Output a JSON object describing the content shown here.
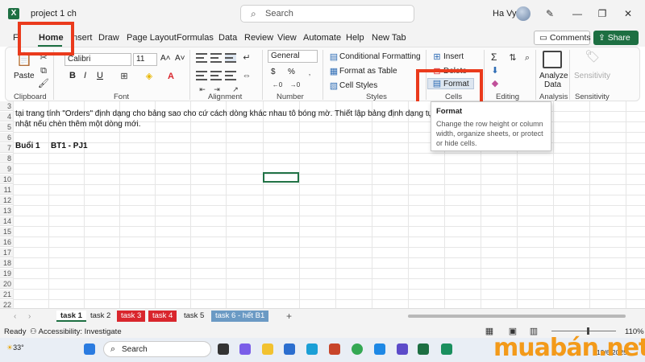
{
  "titlebar": {
    "app_icon": "X",
    "doc_title": "project 1 ch",
    "search_placeholder": "Search",
    "user": "Ha Vy",
    "min": "—",
    "restore": "❐",
    "close": "✕",
    "pen": "✎"
  },
  "tabs": [
    "Fi",
    "Home",
    "nsert",
    "Draw",
    "Page Layout",
    "Formulas",
    "Data",
    "Review",
    "View",
    "Automate",
    "Help",
    "New Tab"
  ],
  "buttons": {
    "comments": "Comments",
    "share": "Share"
  },
  "ribbon": {
    "clipboard": {
      "paste": "Paste",
      "label": "Clipboard"
    },
    "font": {
      "name": "Calibri",
      "size": "11",
      "label": "Font",
      "grow": "A˄",
      "shrink": "A˅",
      "bold": "B",
      "italic": "I",
      "underline": "U"
    },
    "alignment": {
      "label": "Alignment"
    },
    "number": {
      "format": "General",
      "label": "Number",
      "currency": "$",
      "percent": "%"
    },
    "styles": {
      "conditional": "Conditional Formatting",
      "table": "Format as Table",
      "cell_styles": "Cell Styles",
      "label": "Styles"
    },
    "cells": {
      "insert": "Insert",
      "delete": "Delete",
      "format": "Format",
      "label": "Cells"
    },
    "editing": {
      "label": "Editing",
      "sum": "Σ"
    },
    "analysis": {
      "analyze": "Analyze",
      "data": "Data",
      "label": "Analysis"
    },
    "sensitivity": {
      "btn": "Sensitivity",
      "label": "Sensitivity"
    }
  },
  "tooltip": {
    "title": "Format",
    "desc": "Change the row height or column width, organize sheets, or protect or hide cells."
  },
  "grid": {
    "rows": [
      "3",
      "4",
      "5",
      "6",
      "7",
      "8",
      "9",
      "10",
      "11",
      "12",
      "13",
      "14",
      "15",
      "16",
      "17",
      "18",
      "19",
      "20",
      "21",
      "22"
    ],
    "line4": "tại trang tính \"Orders\" định dạng cho bảng sao cho cứ cách dòng khác nhau tô bóng mờ. Thiết lập bảng định dạng tự động cập",
    "line5": "nhật nếu chèn thêm một dòng mới.",
    "b7a": "Buổi 1",
    "b7b": "BT1 - PJ1"
  },
  "sheets": [
    "task 1",
    "task 2",
    "task 3",
    "task 4",
    "task 5",
    "task 6 - hết B1"
  ],
  "add_sheet": "+",
  "status": {
    "ready": "Ready",
    "accessibility": "Accessibility: Investigate",
    "zoom": "110%"
  },
  "taskbar": {
    "weather": "33°",
    "search": "Search",
    "time": "19/6/2025"
  },
  "watermark": "muabán.net",
  "colors": {
    "excel_green": "#1d6f42",
    "highlight": "#ea3a1c",
    "tab_red": "#d9262d",
    "tab_blue": "#6b9ac4"
  }
}
